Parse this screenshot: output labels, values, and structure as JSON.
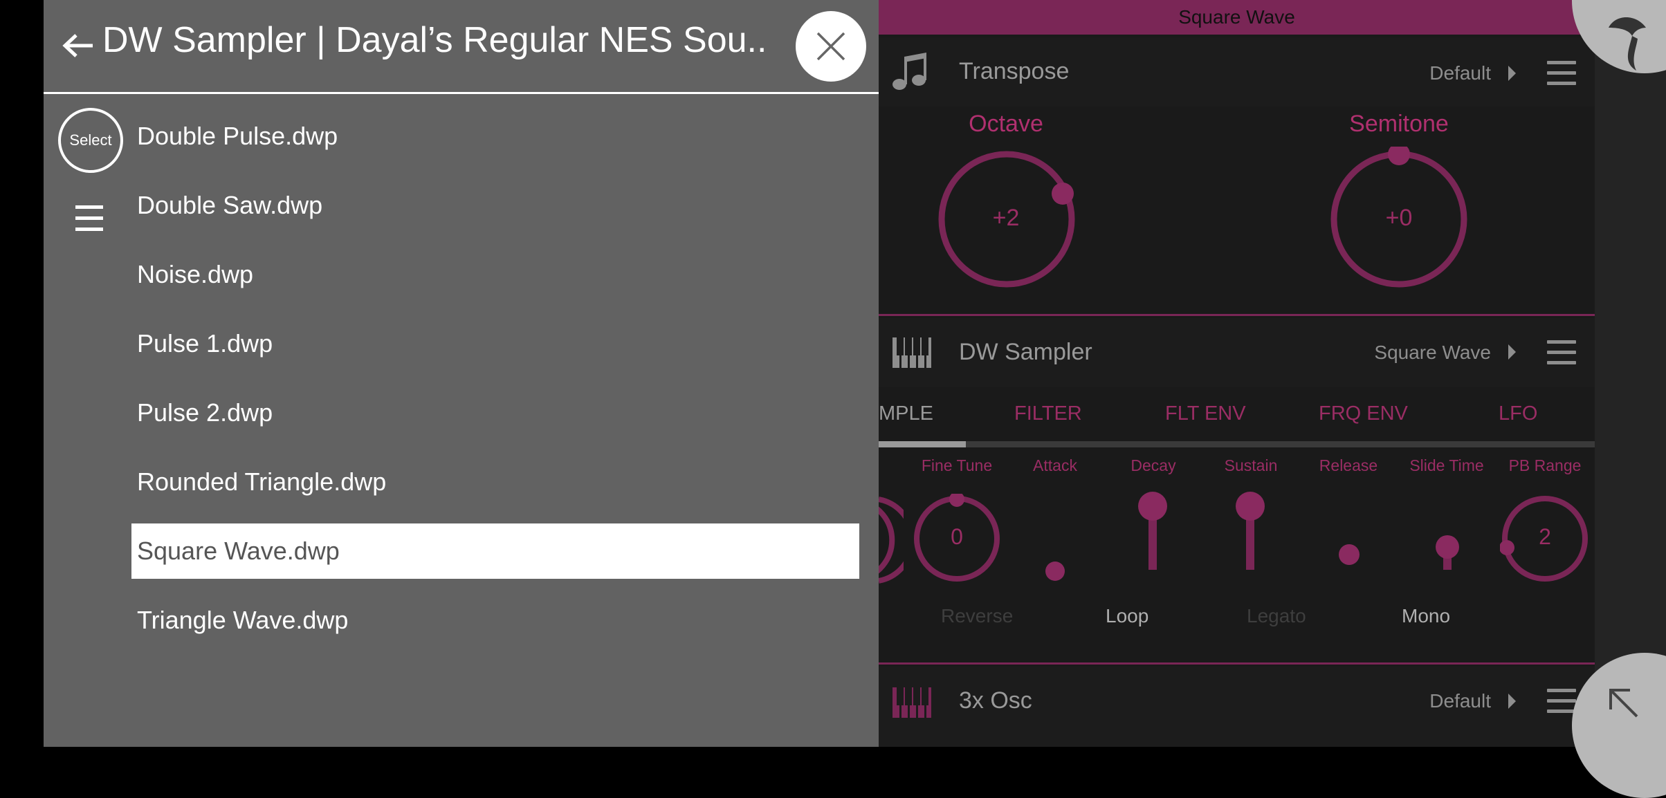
{
  "browser": {
    "title": "DW Sampler | Dayal’s Regular NES Sou...",
    "select_label": "Select",
    "files": [
      {
        "name": "Double Pulse.dwp",
        "selected": false
      },
      {
        "name": "Double Saw.dwp",
        "selected": false
      },
      {
        "name": "Noise.dwp",
        "selected": false
      },
      {
        "name": "Pulse 1.dwp",
        "selected": false
      },
      {
        "name": "Pulse 2.dwp",
        "selected": false
      },
      {
        "name": "Rounded Triangle.dwp",
        "selected": false
      },
      {
        "name": "Square Wave.dwp",
        "selected": true
      },
      {
        "name": "Triangle Wave.dwp",
        "selected": false
      }
    ]
  },
  "topbar": {
    "title": "Square Wave"
  },
  "transpose": {
    "title": "Transpose",
    "preset": "Default",
    "icon": "music-note-icon",
    "octave": {
      "label": "Octave",
      "value": "+2"
    },
    "semitone": {
      "label": "Semitone",
      "value": "+0"
    }
  },
  "sampler": {
    "title": "DW Sampler",
    "preset": "Square Wave",
    "icon": "piano-keys-icon",
    "tabs": [
      "MPLE",
      "FILTER",
      "FLT ENV",
      "FRQ ENV",
      "LFO"
    ],
    "controls": {
      "fine_tune": {
        "label": "Fine Tune",
        "value": "0"
      },
      "attack": {
        "label": "Attack",
        "level": 0
      },
      "decay": {
        "label": "Decay",
        "level": 1
      },
      "sustain": {
        "label": "Sustain",
        "level": 1
      },
      "release": {
        "label": "Release",
        "level": 0.2
      },
      "slide_time": {
        "label": "Slide Time",
        "level": 0.3
      },
      "pb_range": {
        "label": "PB Range",
        "value": "2"
      }
    },
    "options": [
      {
        "label": "Reverse",
        "active": false
      },
      {
        "label": "Loop",
        "active": true
      },
      {
        "label": "Legato",
        "active": false
      },
      {
        "label": "Mono",
        "active": true
      }
    ]
  },
  "osc": {
    "title": "3x Osc",
    "preset": "Default",
    "icon": "piano-keys-icon"
  },
  "colors": {
    "accent": "#7a2656",
    "overlay": "#626262"
  }
}
